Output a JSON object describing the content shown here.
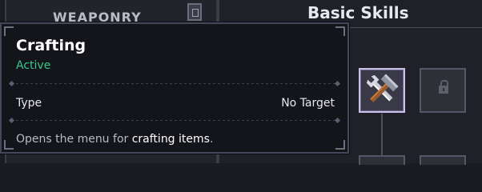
{
  "left_panel": {
    "header": "WEAPONRY"
  },
  "skills_panel": {
    "title": "Basic Skills",
    "slots": [
      {
        "name": "crafting",
        "state": "selected",
        "icon": "hammer-wrench-icon"
      },
      {
        "name": "locked",
        "state": "locked",
        "icon": "lock-icon"
      }
    ]
  },
  "tooltip": {
    "title": "Crafting",
    "status": "Active",
    "status_color": "#37c98b",
    "type_label": "Type",
    "type_value": "No Target",
    "description_prefix": "Opens the menu for ",
    "description_highlight": "crafting items",
    "description_suffix": "."
  }
}
